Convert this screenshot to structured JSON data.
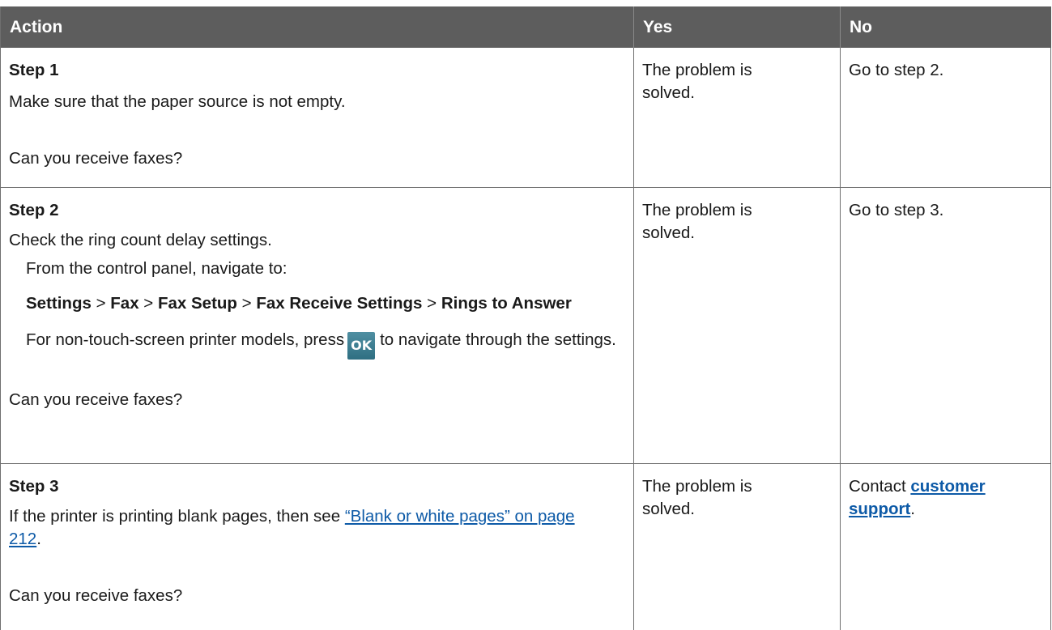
{
  "header": {
    "action": "Action",
    "yes": "Yes",
    "no": "No"
  },
  "step1": {
    "title": "Step 1",
    "text": "Make sure that the paper source is not empty.",
    "question": "Can you receive faxes?",
    "yes": "The problem is solved.",
    "no": "Go to step 2."
  },
  "step2": {
    "title": "Step 2",
    "text": "Check the ring count delay settings.",
    "nav_intro": "From the control panel, navigate to:",
    "path": {
      "settings": "Settings",
      "fax": "Fax",
      "fax_setup": "Fax Setup",
      "fax_receive": "Fax Receive Settings",
      "rings": "Rings to Answer",
      "sep": ">"
    },
    "note_before": "For non-touch-screen printer models, press",
    "ok_label": "OK",
    "note_after": "to navigate through the settings.",
    "question": "Can you receive faxes?",
    "yes": "The problem is solved.",
    "no": "Go to step 3."
  },
  "step3": {
    "title": "Step 3",
    "text_before": "If the printer is printing blank pages, then see",
    "link": "“Blank or white pages” on page 212",
    "text_after": ".",
    "question": "Can you receive faxes?",
    "yes": "The problem is solved.",
    "no_before": "Contact",
    "no_link": "customer support",
    "no_after": "."
  },
  "colors": {
    "header_bg": "#5d5d5d",
    "link": "#0d5aa7",
    "ok_key": "#3d7e91"
  },
  "icons": {
    "ok_button": "ok-key-icon"
  }
}
